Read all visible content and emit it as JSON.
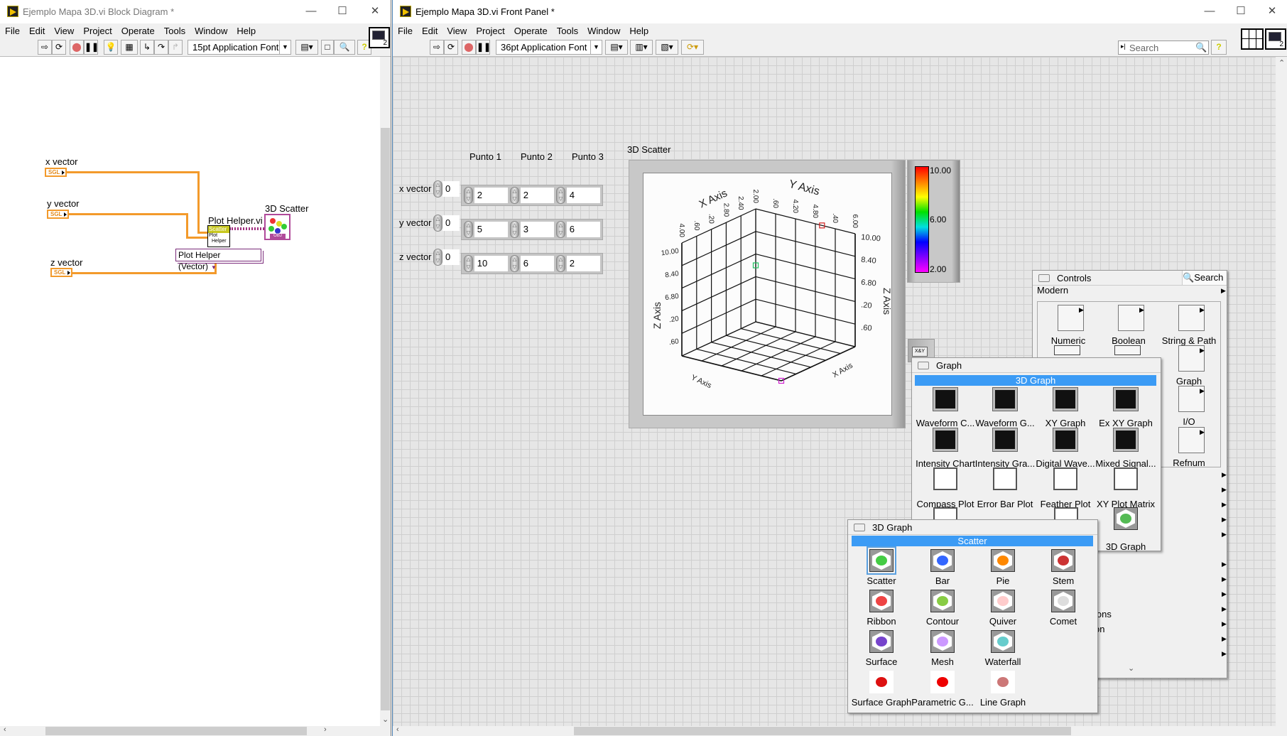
{
  "block_diagram": {
    "title": "Ejemplo Mapa 3D.vi Block Diagram *",
    "menu": [
      "File",
      "Edit",
      "View",
      "Project",
      "Operate",
      "Tools",
      "Window",
      "Help"
    ],
    "font_selector": "15pt Application Font",
    "terminals": [
      {
        "label": "x vector",
        "type": "SGL"
      },
      {
        "label": "y vector",
        "type": "SGL"
      },
      {
        "label": "z vector",
        "type": "SGL"
      }
    ],
    "plot_helper": {
      "label": "Plot Helper.vi",
      "band": "Scatter",
      "line1": "Plot",
      "line2": "Helper",
      "selector": "Plot Helper (Vector)"
    },
    "scatter_terminal": {
      "label": "3D Scatter",
      "badge": "OBJ"
    },
    "context_help_count": "2"
  },
  "front_panel": {
    "title": "Ejemplo Mapa 3D.vi Front Panel *",
    "menu": [
      "File",
      "Edit",
      "View",
      "Project",
      "Operate",
      "Tools",
      "Window",
      "Help"
    ],
    "font_selector": "36pt Application Font",
    "search_placeholder": "Search",
    "context_help_count": "2",
    "columns": [
      "Punto 1",
      "Punto 2",
      "Punto 3"
    ],
    "arrays": [
      {
        "label": "x vector",
        "index": "0",
        "values": [
          "2",
          "2",
          "4"
        ]
      },
      {
        "label": "y vector",
        "index": "0",
        "values": [
          "5",
          "3",
          "6"
        ]
      },
      {
        "label": "z vector",
        "index": "0",
        "values": [
          "10",
          "6",
          "2"
        ]
      }
    ],
    "graph_label": "3D Scatter",
    "colorbar": {
      "ticks": [
        "10.00",
        "6.00",
        "2.00"
      ],
      "colors": [
        "#ff0000",
        "#ff8000",
        "#ffff00",
        "#00e000",
        "#00e0e0",
        "#0000ff",
        "#8000ff",
        "#ff00ff"
      ]
    },
    "xy_badge": "X&Y"
  },
  "palettes": {
    "controls": {
      "title": "Controls",
      "search": "Search",
      "category": "Modern",
      "items": [
        {
          "label": "Numeric",
          "icon": "numeric-icon"
        },
        {
          "label": "Boolean",
          "icon": "boolean-icon"
        },
        {
          "label": "String & Path",
          "icon": "string-path-icon"
        },
        {
          "label": "Graph",
          "icon": "graph-icon"
        },
        {
          "label": "I/O",
          "icon": "io-icon"
        },
        {
          "label": "Refnum",
          "icon": "refnum-icon"
        }
      ],
      "partial_labels": [
        "ions",
        "on"
      ]
    },
    "graph": {
      "title": "Graph",
      "highlight": "3D Graph",
      "items": [
        {
          "label": "Waveform C..."
        },
        {
          "label": "Waveform G..."
        },
        {
          "label": "XY Graph"
        },
        {
          "label": "Ex XY Graph"
        },
        {
          "label": "Intensity Chart"
        },
        {
          "label": "Intensity Gra..."
        },
        {
          "label": "Digital Wave..."
        },
        {
          "label": "Mixed Signal..."
        },
        {
          "label": "Compass Plot"
        },
        {
          "label": "Error Bar Plot"
        },
        {
          "label": "Feather Plot"
        },
        {
          "label": "XY Plot Matrix"
        },
        {
          "label": "3D Graph"
        }
      ]
    },
    "graph3d": {
      "title": "3D Graph",
      "highlight": "Scatter",
      "items": [
        {
          "label": "Scatter",
          "color": "#4c4"
        },
        {
          "label": "Bar",
          "color": "#36f"
        },
        {
          "label": "Pie",
          "color": "#f80"
        },
        {
          "label": "Stem",
          "color": "#c33"
        },
        {
          "label": "Ribbon",
          "color": "#e44"
        },
        {
          "label": "Contour",
          "color": "#8c4"
        },
        {
          "label": "Quiver",
          "color": "#fcc"
        },
        {
          "label": "Comet",
          "color": "#ddd"
        },
        {
          "label": "Surface",
          "color": "#74c"
        },
        {
          "label": "Mesh",
          "color": "#c9f"
        },
        {
          "label": "Waterfall",
          "color": "#6cc"
        },
        {
          "label": "Surface Graph",
          "color": "#d11"
        },
        {
          "label": "Parametric G...",
          "color": "#e00"
        },
        {
          "label": "Line Graph",
          "color": "#c77"
        }
      ],
      "selected": "Scatter"
    }
  },
  "chart_data": {
    "type": "scatter",
    "title": "3D Scatter",
    "points": [
      {
        "x": 2,
        "y": 5,
        "z": 10,
        "color": "#d02020"
      },
      {
        "x": 2,
        "y": 3,
        "z": 6,
        "color": "#20c060"
      },
      {
        "x": 4,
        "y": 6,
        "z": 2,
        "color": "#d020d0"
      }
    ],
    "xlabel": "X Axis",
    "ylabel": "Y Axis",
    "zlabel": "Z Axis",
    "xlim": [
      2,
      4
    ],
    "ylim": [
      3,
      6
    ],
    "zlim": [
      2,
      10
    ],
    "x_ticks": [
      "2.00",
      "2.40",
      "2.80",
      ".20",
      ".60",
      "4.00"
    ],
    "y_ticks": [
      ".60",
      "4.20",
      "4.80",
      ".40",
      "6.00"
    ],
    "z_ticks_left": [
      ".60",
      ".20",
      "6.80",
      "8.40",
      "10.00"
    ],
    "z_ticks_right": [
      ".60",
      ".20",
      "6.80",
      "8.40",
      "10.00"
    ],
    "grid": true
  }
}
